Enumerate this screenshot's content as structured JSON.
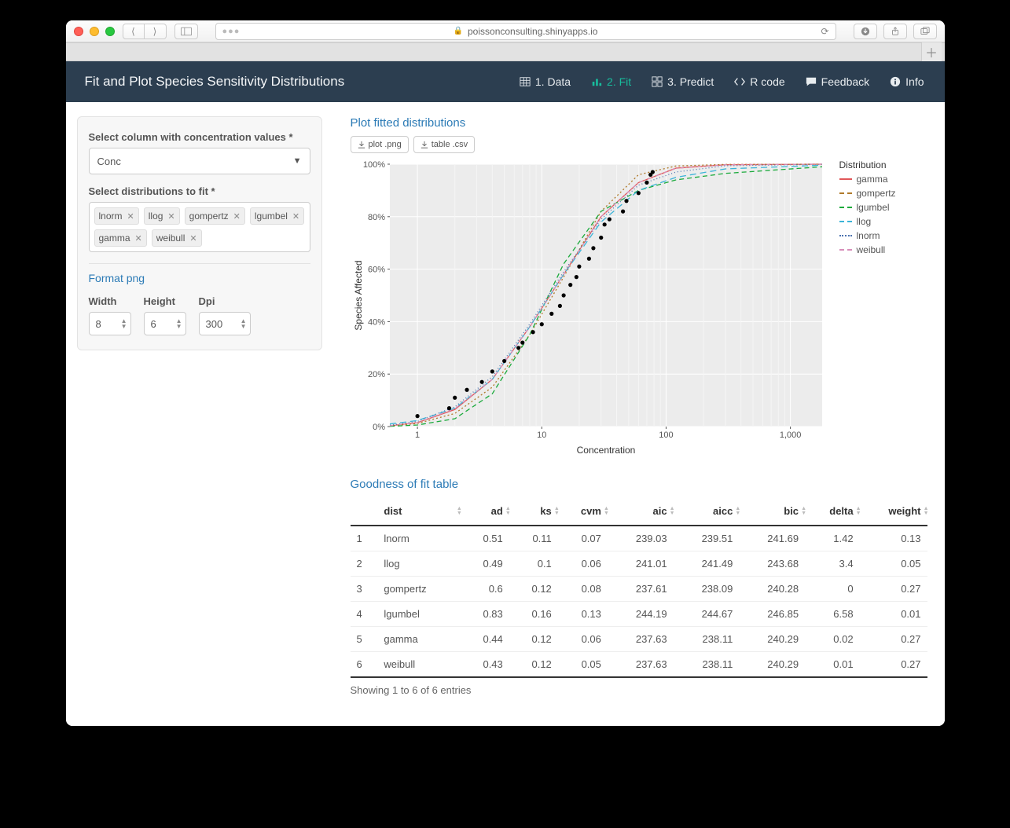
{
  "browser": {
    "url": "poissonconsulting.shinyapps.io"
  },
  "app": {
    "title": "Fit and Plot Species Sensitivity Distributions"
  },
  "nav": [
    "1. Data",
    "2. Fit",
    "3. Predict",
    "R code",
    "Feedback",
    "Info"
  ],
  "sidebar": {
    "column_label": "Select column with concentration values *",
    "column_value": "Conc",
    "dist_label": "Select distributions to fit *",
    "distributions": [
      "lnorm",
      "llog",
      "gompertz",
      "lgumbel",
      "gamma",
      "weibull"
    ],
    "png": {
      "head": "Format png",
      "width_label": "Width",
      "width": "8",
      "height_label": "Height",
      "height": "6",
      "dpi_label": "Dpi",
      "dpi": "300"
    }
  },
  "main": {
    "plot_title": "Plot fitted distributions",
    "btn_plot": "plot .png",
    "btn_table": "table .csv",
    "gof_title": "Goodness of fit table",
    "table_info": "Showing 1 to 6 of 6 entries"
  },
  "chart_data": {
    "type": "line",
    "title": "",
    "xlabel": "Concentration",
    "ylabel": "Species Affected",
    "x_log": true,
    "x_ticks": [
      1,
      10,
      100,
      1000
    ],
    "y_ticks": [
      0,
      20,
      40,
      60,
      80,
      100
    ],
    "y_tick_labels": [
      "0%",
      "20%",
      "40%",
      "60%",
      "80%",
      "100%"
    ],
    "xlim": [
      0.6,
      1800
    ],
    "ylim": [
      0,
      100
    ],
    "legend_title": "Distribution",
    "points": [
      {
        "x": 1.0,
        "y": 4
      },
      {
        "x": 1.8,
        "y": 7
      },
      {
        "x": 2.0,
        "y": 11
      },
      {
        "x": 2.5,
        "y": 14
      },
      {
        "x": 3.3,
        "y": 17
      },
      {
        "x": 4.0,
        "y": 21
      },
      {
        "x": 5.0,
        "y": 25
      },
      {
        "x": 6.5,
        "y": 30
      },
      {
        "x": 7.0,
        "y": 32
      },
      {
        "x": 8.5,
        "y": 36
      },
      {
        "x": 10.0,
        "y": 39
      },
      {
        "x": 12.0,
        "y": 43
      },
      {
        "x": 14.0,
        "y": 46
      },
      {
        "x": 15.0,
        "y": 50
      },
      {
        "x": 17.0,
        "y": 54
      },
      {
        "x": 19.0,
        "y": 57
      },
      {
        "x": 20.0,
        "y": 61
      },
      {
        "x": 24.0,
        "y": 64
      },
      {
        "x": 26.0,
        "y": 68
      },
      {
        "x": 30.0,
        "y": 72
      },
      {
        "x": 32.0,
        "y": 77
      },
      {
        "x": 35.0,
        "y": 79
      },
      {
        "x": 45.0,
        "y": 82
      },
      {
        "x": 48.0,
        "y": 86
      },
      {
        "x": 60.0,
        "y": 89
      },
      {
        "x": 70.0,
        "y": 93
      },
      {
        "x": 75.0,
        "y": 96
      },
      {
        "x": 78.0,
        "y": 97
      }
    ],
    "series": [
      {
        "name": "gamma",
        "color": "#E15759",
        "dash": "",
        "values": [
          [
            0.6,
            0.3
          ],
          [
            1,
            1.5
          ],
          [
            2,
            6.5
          ],
          [
            4,
            18
          ],
          [
            8,
            38
          ],
          [
            15,
            58
          ],
          [
            30,
            80
          ],
          [
            60,
            93
          ],
          [
            120,
            98.5
          ],
          [
            300,
            99.8
          ],
          [
            1800,
            100
          ]
        ]
      },
      {
        "name": "gompertz",
        "color": "#B07A2A",
        "dash": "2,3",
        "values": [
          [
            0.6,
            0.2
          ],
          [
            1,
            1.2
          ],
          [
            2,
            5
          ],
          [
            4,
            15
          ],
          [
            8,
            35
          ],
          [
            15,
            57
          ],
          [
            30,
            82
          ],
          [
            60,
            96
          ],
          [
            120,
            99.3
          ],
          [
            300,
            99.9
          ],
          [
            1800,
            100
          ]
        ]
      },
      {
        "name": "lgumbel",
        "color": "#1BAA3C",
        "dash": "6,4",
        "values": [
          [
            0.6,
            0.1
          ],
          [
            1,
            0.6
          ],
          [
            2,
            3
          ],
          [
            4,
            12.5
          ],
          [
            8,
            35
          ],
          [
            15,
            62
          ],
          [
            30,
            82
          ],
          [
            60,
            90
          ],
          [
            120,
            94
          ],
          [
            300,
            96.5
          ],
          [
            1800,
            99
          ]
        ]
      },
      {
        "name": "llog",
        "color": "#3BB4D8",
        "dash": "8,5",
        "values": [
          [
            0.6,
            1
          ],
          [
            1,
            2.3
          ],
          [
            2,
            7
          ],
          [
            4,
            18
          ],
          [
            8,
            38
          ],
          [
            15,
            58
          ],
          [
            30,
            78
          ],
          [
            60,
            90
          ],
          [
            120,
            95
          ],
          [
            300,
            98.2
          ],
          [
            1800,
            99.6
          ]
        ]
      },
      {
        "name": "lnorm",
        "color": "#4C72B0",
        "dash": "1,3",
        "values": [
          [
            0.6,
            0.5
          ],
          [
            1,
            2
          ],
          [
            2,
            7.5
          ],
          [
            4,
            19
          ],
          [
            8,
            39
          ],
          [
            15,
            59
          ],
          [
            30,
            79
          ],
          [
            60,
            92
          ],
          [
            120,
            97
          ],
          [
            300,
            99.4
          ],
          [
            1800,
            99.95
          ]
        ]
      },
      {
        "name": "weibull",
        "color": "#D88FBA",
        "dash": "4,3,1,3",
        "values": [
          [
            0.6,
            0.3
          ],
          [
            1,
            1.5
          ],
          [
            2,
            6.8
          ],
          [
            4,
            18
          ],
          [
            8,
            38
          ],
          [
            15,
            58
          ],
          [
            30,
            80
          ],
          [
            60,
            93
          ],
          [
            120,
            98.4
          ],
          [
            300,
            99.8
          ],
          [
            1800,
            100
          ]
        ]
      }
    ]
  },
  "gof": {
    "columns": [
      "",
      "dist",
      "ad",
      "ks",
      "cvm",
      "aic",
      "aicc",
      "bic",
      "delta",
      "weight"
    ],
    "rows": [
      [
        "1",
        "lnorm",
        "0.51",
        "0.11",
        "0.07",
        "239.03",
        "239.51",
        "241.69",
        "1.42",
        "0.13"
      ],
      [
        "2",
        "llog",
        "0.49",
        "0.1",
        "0.06",
        "241.01",
        "241.49",
        "243.68",
        "3.4",
        "0.05"
      ],
      [
        "3",
        "gompertz",
        "0.6",
        "0.12",
        "0.08",
        "237.61",
        "238.09",
        "240.28",
        "0",
        "0.27"
      ],
      [
        "4",
        "lgumbel",
        "0.83",
        "0.16",
        "0.13",
        "244.19",
        "244.67",
        "246.85",
        "6.58",
        "0.01"
      ],
      [
        "5",
        "gamma",
        "0.44",
        "0.12",
        "0.06",
        "237.63",
        "238.11",
        "240.29",
        "0.02",
        "0.27"
      ],
      [
        "6",
        "weibull",
        "0.43",
        "0.12",
        "0.05",
        "237.63",
        "238.11",
        "240.29",
        "0.01",
        "0.27"
      ]
    ]
  }
}
